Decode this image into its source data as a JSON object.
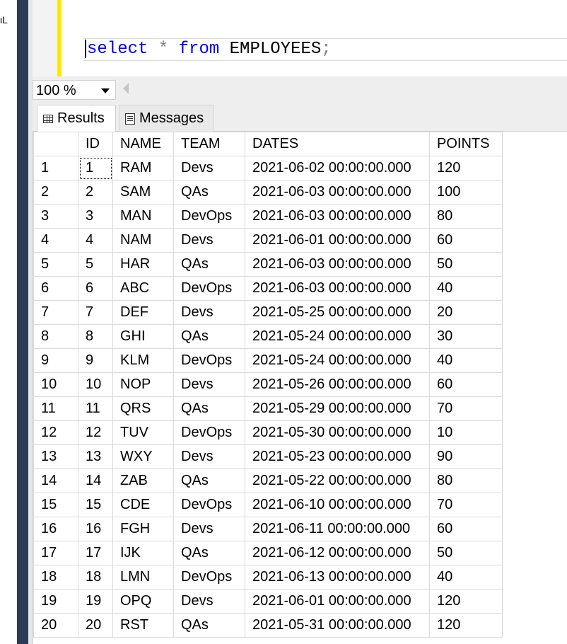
{
  "left_edge": {
    "fragment_text": "ιL"
  },
  "editor": {
    "tokens": {
      "kw1": "select",
      "star": "*",
      "kw2": "from",
      "table": "EMPLOYEES",
      "semicolon": ";"
    }
  },
  "zoom": {
    "value": "100 %"
  },
  "tabs": {
    "results": "Results",
    "messages": "Messages"
  },
  "results": {
    "columns": [
      "ID",
      "NAME",
      "TEAM",
      "DATES",
      "POINTS"
    ],
    "rows": [
      [
        "1",
        "1",
        "RAM",
        "Devs",
        "2021-06-02 00:00:00.000",
        "120"
      ],
      [
        "2",
        "2",
        "SAM",
        "QAs",
        "2021-06-03 00:00:00.000",
        "100"
      ],
      [
        "3",
        "3",
        "MAN",
        "DevOps",
        "2021-06-03 00:00:00.000",
        "80"
      ],
      [
        "4",
        "4",
        "NAM",
        "Devs",
        "2021-06-01 00:00:00.000",
        "60"
      ],
      [
        "5",
        "5",
        "HAR",
        "QAs",
        "2021-06-03 00:00:00.000",
        "50"
      ],
      [
        "6",
        "6",
        "ABC",
        "DevOps",
        "2021-06-03 00:00:00.000",
        "40"
      ],
      [
        "7",
        "7",
        "DEF",
        "Devs",
        "2021-05-25 00:00:00.000",
        "20"
      ],
      [
        "8",
        "8",
        "GHI",
        "QAs",
        "2021-05-24 00:00:00.000",
        "30"
      ],
      [
        "9",
        "9",
        "KLM",
        "DevOps",
        "2021-05-24 00:00:00.000",
        "40"
      ],
      [
        "10",
        "10",
        "NOP",
        "Devs",
        "2021-05-26 00:00:00.000",
        "60"
      ],
      [
        "11",
        "11",
        "QRS",
        "QAs",
        "2021-05-29 00:00:00.000",
        "70"
      ],
      [
        "12",
        "12",
        "TUV",
        "DevOps",
        "2021-05-30 00:00:00.000",
        "10"
      ],
      [
        "13",
        "13",
        "WXY",
        "Devs",
        "2021-05-23 00:00:00.000",
        "90"
      ],
      [
        "14",
        "14",
        "ZAB",
        "QAs",
        "2021-05-22 00:00:00.000",
        "80"
      ],
      [
        "15",
        "15",
        "CDE",
        "DevOps",
        "2021-06-10 00:00:00.000",
        "70"
      ],
      [
        "16",
        "16",
        "FGH",
        "Devs",
        "2021-06-11 00:00:00.000",
        "60"
      ],
      [
        "17",
        "17",
        "IJK",
        "QAs",
        "2021-06-12 00:00:00.000",
        "50"
      ],
      [
        "18",
        "18",
        "LMN",
        "DevOps",
        "2021-06-13 00:00:00.000",
        "40"
      ],
      [
        "19",
        "19",
        "OPQ",
        "Devs",
        "2021-06-01 00:00:00.000",
        "120"
      ],
      [
        "20",
        "20",
        "RST",
        "QAs",
        "2021-05-31 00:00:00.000",
        "120"
      ]
    ]
  },
  "colors": {
    "keyword": "#0000ff",
    "operator": "#808080",
    "change_marker": "#ffe600",
    "sidebar": "#2b3a55",
    "grid_border": "#d9d9d9"
  },
  "icons": {
    "results_tab": "grid-icon",
    "messages_tab": "messages-icon",
    "zoom_dropdown": "chevron-down-icon",
    "scroll": "scroll-left-arrow-icon"
  }
}
